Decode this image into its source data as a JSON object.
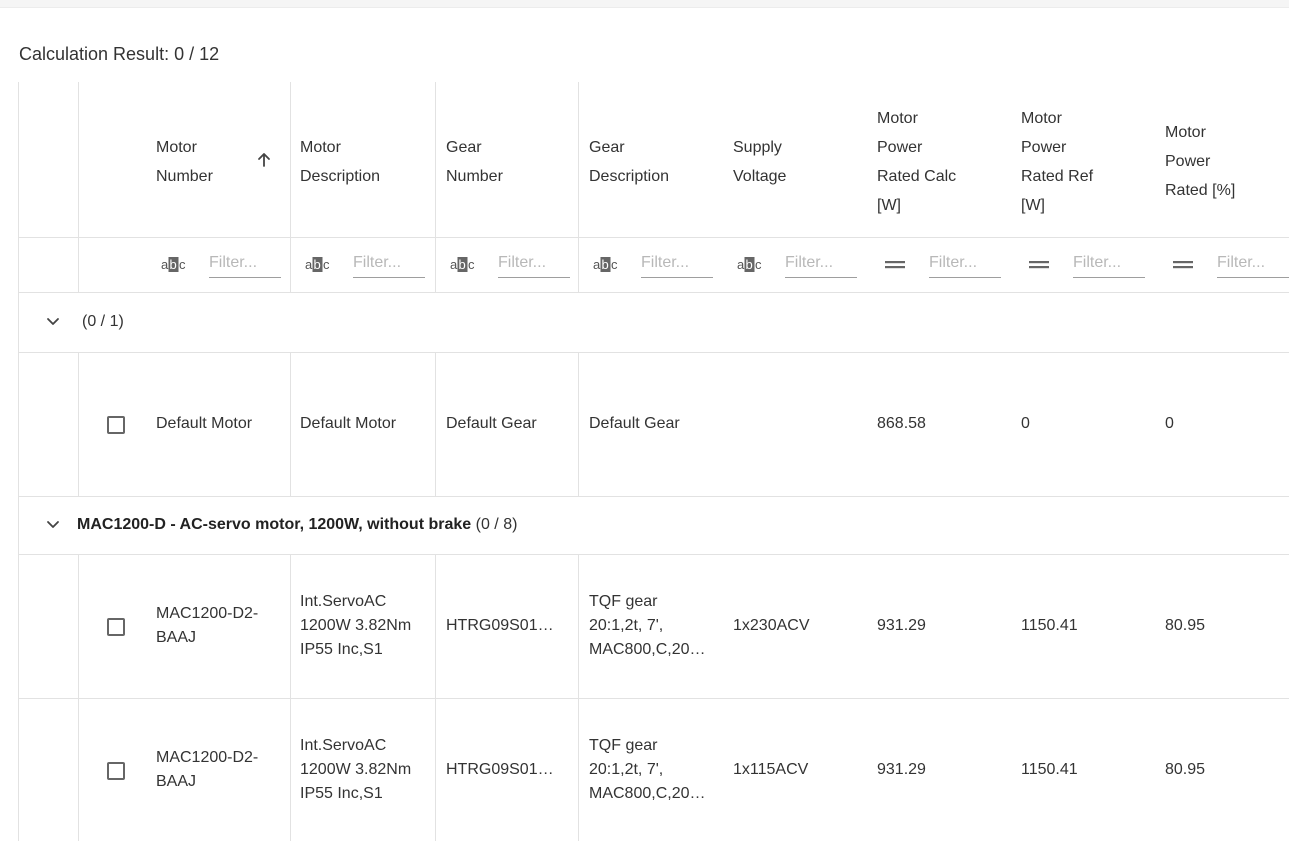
{
  "result": {
    "label": "Calculation Result:",
    "value": "0 / 12"
  },
  "columns": [
    {
      "key": "motor_number",
      "label": [
        "Motor",
        "Number"
      ],
      "filter_icon": "abc-text-icon",
      "sorted": "asc"
    },
    {
      "key": "motor_description",
      "label": [
        "Motor",
        "Description"
      ],
      "filter_icon": "abc-text-icon"
    },
    {
      "key": "gear_number",
      "label": [
        "Gear",
        "Number"
      ],
      "filter_icon": "abc-text-icon"
    },
    {
      "key": "gear_description",
      "label": [
        "Gear",
        "Description"
      ],
      "filter_icon": "abc-text-icon"
    },
    {
      "key": "supply_voltage",
      "label": [
        "Supply",
        "Voltage"
      ],
      "filter_icon": "abc-text-icon"
    },
    {
      "key": "motor_power_rated_calc",
      "label": [
        "Motor",
        "Power",
        "Rated Calc",
        "[W]"
      ],
      "filter_icon": "equals-icon"
    },
    {
      "key": "motor_power_rated_ref",
      "label": [
        "Motor",
        "Power",
        "Rated Ref",
        "[W]"
      ],
      "filter_icon": "equals-icon"
    },
    {
      "key": "motor_power_rated_pct",
      "label": [
        "Motor",
        "Power",
        "Rated [%]"
      ],
      "filter_icon": "equals-icon"
    }
  ],
  "filter_placeholder": "Filter...",
  "groups": [
    {
      "title": "",
      "count": "(0 / 1)",
      "rows": [
        {
          "motor_number": [
            "Default Motor"
          ],
          "motor_description": [
            "Default Motor"
          ],
          "gear_number": "Default Gear",
          "gear_description": [
            "Default Gear"
          ],
          "supply_voltage": "",
          "motor_power_rated_calc": "868.58",
          "motor_power_rated_ref": "0",
          "motor_power_rated_pct": "0"
        }
      ]
    },
    {
      "title": "MAC1200-D - AC-servo motor, 1200W, without brake",
      "count": "(0 / 8)",
      "rows": [
        {
          "motor_number": [
            "MAC1200-D2-",
            "BAAJ"
          ],
          "motor_description": [
            "Int.ServoAC",
            "1200W 3.82Nm",
            "IP55 Inc,S1"
          ],
          "gear_number": "HTRG09S01…",
          "gear_description": [
            "TQF gear",
            "20:1,2t, 7',",
            "MAC800,C,20…"
          ],
          "supply_voltage": "1x230ACV",
          "motor_power_rated_calc": "931.29",
          "motor_power_rated_ref": "1150.41",
          "motor_power_rated_pct": "80.95"
        },
        {
          "motor_number": [
            "MAC1200-D2-",
            "BAAJ"
          ],
          "motor_description": [
            "Int.ServoAC",
            "1200W 3.82Nm",
            "IP55 Inc,S1"
          ],
          "gear_number": "HTRG09S01…",
          "gear_description": [
            "TQF gear",
            "20:1,2t, 7',",
            "MAC800,C,20…"
          ],
          "supply_voltage": "1x115ACV",
          "motor_power_rated_calc": "931.29",
          "motor_power_rated_ref": "1150.41",
          "motor_power_rated_pct": "80.95"
        }
      ]
    }
  ]
}
